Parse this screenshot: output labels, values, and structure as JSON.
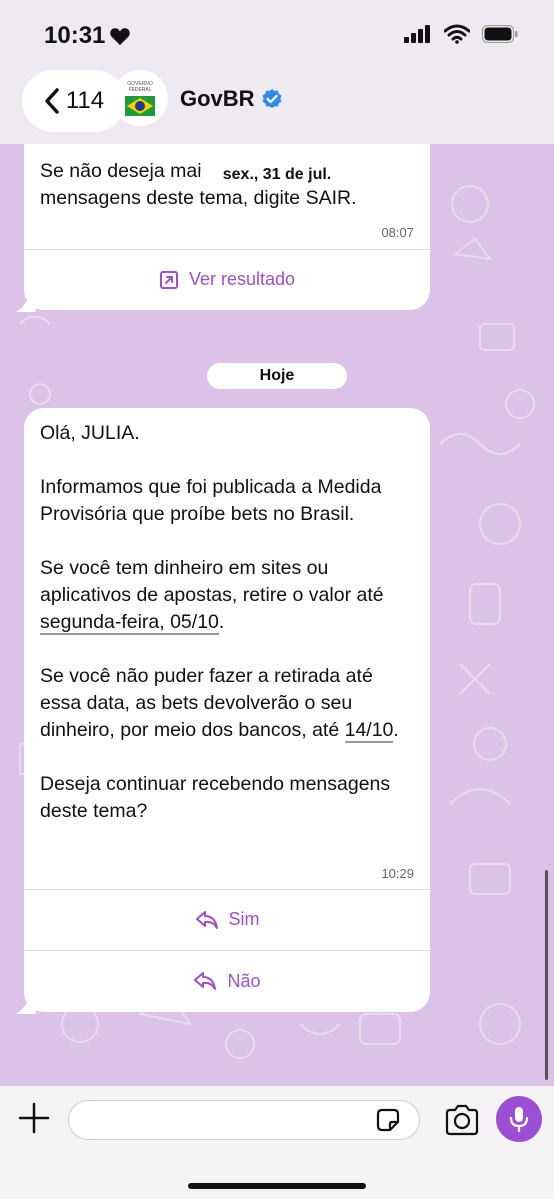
{
  "status_bar": {
    "time": "10:31"
  },
  "header": {
    "back_count": "114",
    "avatar_line1": "GOVERNO",
    "avatar_line2": "FEDERAL",
    "contact_name": "GovBR"
  },
  "messages": {
    "previous": {
      "text_line1": "Se não deseja mais receber",
      "text_line2": "mensagens deste tema, digite SAIR.",
      "time": "08:07",
      "action": "Ver resultado"
    },
    "date_chip_previous": "sex., 31 de jul.",
    "date_chip_today": "Hoje",
    "current": {
      "greeting": "Olá, JULIA.",
      "para1": "Informamos que foi publicada a Medida Provisória que proíbe bets no Brasil.",
      "para2_start": "Se você tem dinheiro em sites ou aplicativos de apostas, retire o valor até ",
      "para2_date": "segunda-feira, 05/10",
      "para2_end": ".",
      "para3_start": "Se você não puder fazer a retirada até essa data, as bets devolverão o seu dinheiro, por meio dos bancos, até ",
      "para3_date": "14/10",
      "para3_end": ".",
      "para4": "Deseja continuar recebendo mensagens deste tema?",
      "time": "10:29",
      "reply_yes": "Sim",
      "reply_no": "Não"
    }
  },
  "composer": {
    "placeholder": ""
  },
  "colors": {
    "chat_background": "#dcc2e6",
    "accent": "#a14fc7",
    "mic_button": "#9c4fd4"
  }
}
